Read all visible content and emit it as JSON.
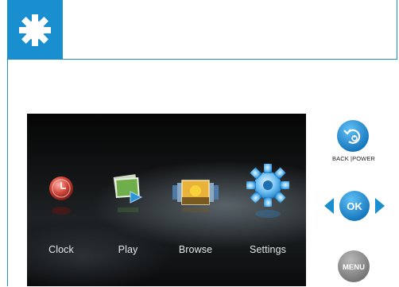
{
  "header": {
    "icon": "gear-icon",
    "color": "#1a8fd0"
  },
  "screen": {
    "menu": [
      {
        "label": "Clock",
        "icon": "clock-icon"
      },
      {
        "label": "Play",
        "icon": "play-photos-icon"
      },
      {
        "label": "Browse",
        "icon": "browse-photos-icon"
      },
      {
        "label": "Settings",
        "icon": "settings-gear-icon",
        "selected": true
      }
    ]
  },
  "controls": {
    "back_power_label": "BACK |POWER",
    "ok_label": "OK",
    "menu_label": "MENU"
  },
  "colors": {
    "accent": "#1a8fd0",
    "menu_button": "#8c8c8c"
  }
}
